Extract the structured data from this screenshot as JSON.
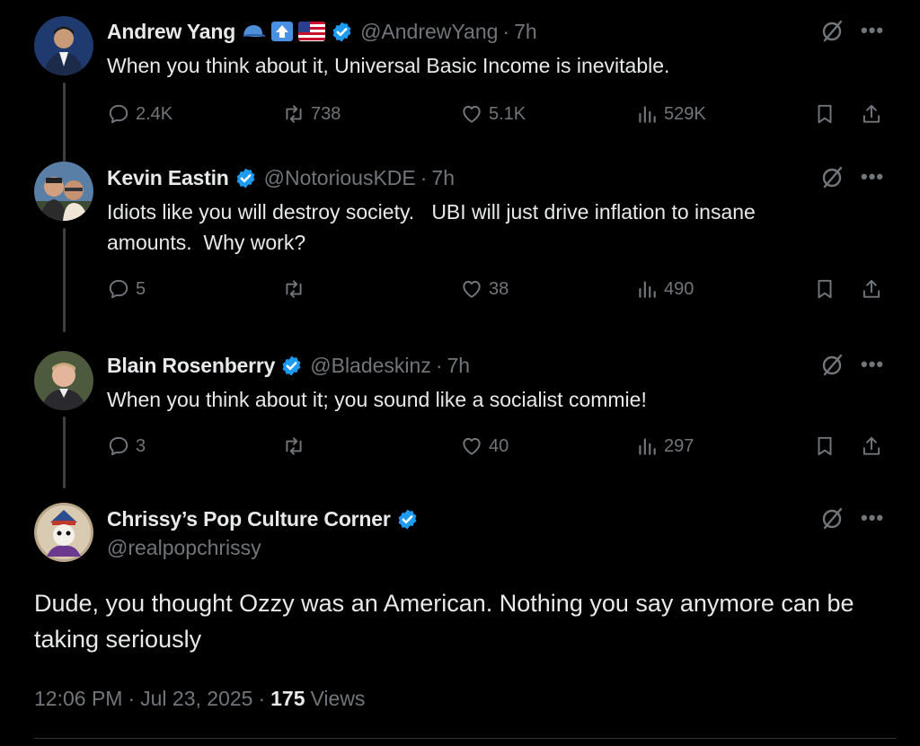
{
  "colors": {
    "background": "#000000",
    "text": "#e7e9ea",
    "muted": "#71767b",
    "verified": "#1d9bf0",
    "thread_line": "#3e4144"
  },
  "replies_thread": [
    {
      "name": "Andrew Yang",
      "name_emojis": [
        "blue-cap-emoji",
        "up-arrow-emoji",
        "us-flag-emoji"
      ],
      "verified": true,
      "handle": "@AndrewYang",
      "separator": "·",
      "time": "7h",
      "text": "When you think about it, Universal Basic Income is inevitable.",
      "stats": {
        "replies": "2.4K",
        "reposts": "738",
        "likes": "5.1K",
        "views": "529K"
      }
    },
    {
      "name": "Kevin Eastin",
      "verified": true,
      "handle": "@NotoriousKDE",
      "separator": "·",
      "time": "7h",
      "text": "Idiots like you will destroy society.   UBI will just drive inflation to insane\namounts.  Why work?",
      "stats": {
        "replies": "5",
        "reposts": "",
        "likes": "38",
        "views": "490"
      }
    },
    {
      "name": "Blain Rosenberry",
      "verified": true,
      "handle": "@Bladeskinz",
      "separator": "·",
      "time": "7h",
      "text": "When you think about it; you sound like a socialist commie!",
      "stats": {
        "replies": "3",
        "reposts": "",
        "likes": "40",
        "views": "297"
      }
    }
  ],
  "main_tweet": {
    "name": "Chrissy’s Pop Culture Corner",
    "verified": true,
    "handle": "@realpopchrissy",
    "text": "Dude, you thought Ozzy was an American. Nothing you say anymore can be taking seriously",
    "time": "12:06 PM",
    "separator": "·",
    "date": "Jul 23, 2025",
    "views_count": "175",
    "views_label": "Views"
  },
  "icons": [
    "reply-icon",
    "repost-icon",
    "like-icon",
    "views-icon",
    "bookmark-icon",
    "share-icon",
    "grok-icon",
    "more-icon",
    "verified-badge-icon"
  ]
}
